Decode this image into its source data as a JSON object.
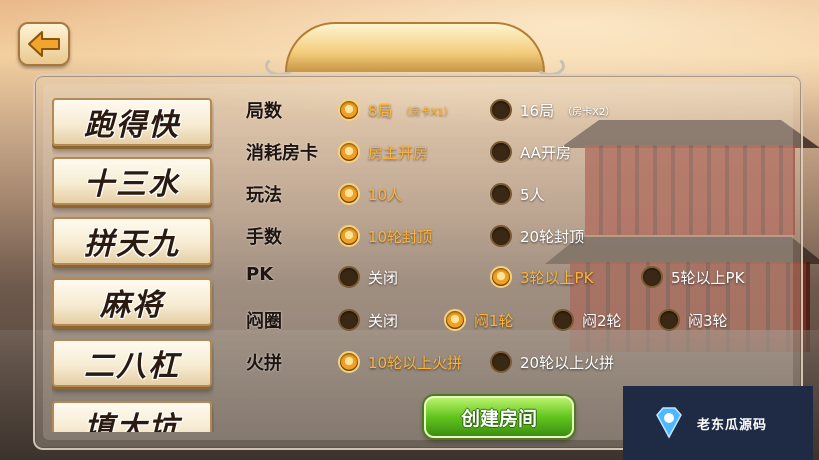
{
  "back_button": {
    "icon": "back-arrow-icon"
  },
  "sidebar": {
    "games": [
      {
        "label": "跑得快"
      },
      {
        "label": "十三水"
      },
      {
        "label": "拼天九"
      },
      {
        "label": "麻将"
      },
      {
        "label": "二八杠"
      },
      {
        "label": "填大坑"
      }
    ]
  },
  "options": [
    {
      "label": "局数",
      "choices": [
        {
          "text": "8局",
          "note": "（房卡X1）",
          "selected": true
        },
        {
          "text": "16局",
          "note": "（房卡X2）",
          "selected": false
        }
      ]
    },
    {
      "label": "消耗房卡",
      "choices": [
        {
          "text": "房主开房",
          "selected": true
        },
        {
          "text": "AA开房",
          "selected": false
        }
      ]
    },
    {
      "label": "玩法",
      "choices": [
        {
          "text": "10人",
          "selected": true
        },
        {
          "text": "5人",
          "selected": false
        }
      ]
    },
    {
      "label": "手数",
      "choices": [
        {
          "text": "10轮封顶",
          "selected": true
        },
        {
          "text": "20轮封顶",
          "selected": false
        }
      ]
    },
    {
      "label": "PK",
      "choices": [
        {
          "text": "关闭",
          "selected": false
        },
        {
          "text": "3轮以上PK",
          "selected": true
        },
        {
          "text": "5轮以上PK",
          "selected": false
        }
      ]
    },
    {
      "label": "闷圈",
      "choices": [
        {
          "text": "关闭",
          "selected": false
        },
        {
          "text": "闷1轮",
          "selected": true
        },
        {
          "text": "闷2轮",
          "selected": false
        },
        {
          "text": "闷3轮",
          "selected": false
        }
      ]
    },
    {
      "label": "火拼",
      "choices": [
        {
          "text": "10轮以上火拼",
          "selected": true
        },
        {
          "text": "20轮以上火拼",
          "selected": false
        }
      ]
    }
  ],
  "create_button": {
    "label": "创建房间"
  },
  "watermark": {
    "text": "老东瓜源码",
    "icon": "diamond-logo-icon"
  },
  "colors": {
    "selected_text": "#ffb233",
    "create_button": "#62c51d"
  }
}
